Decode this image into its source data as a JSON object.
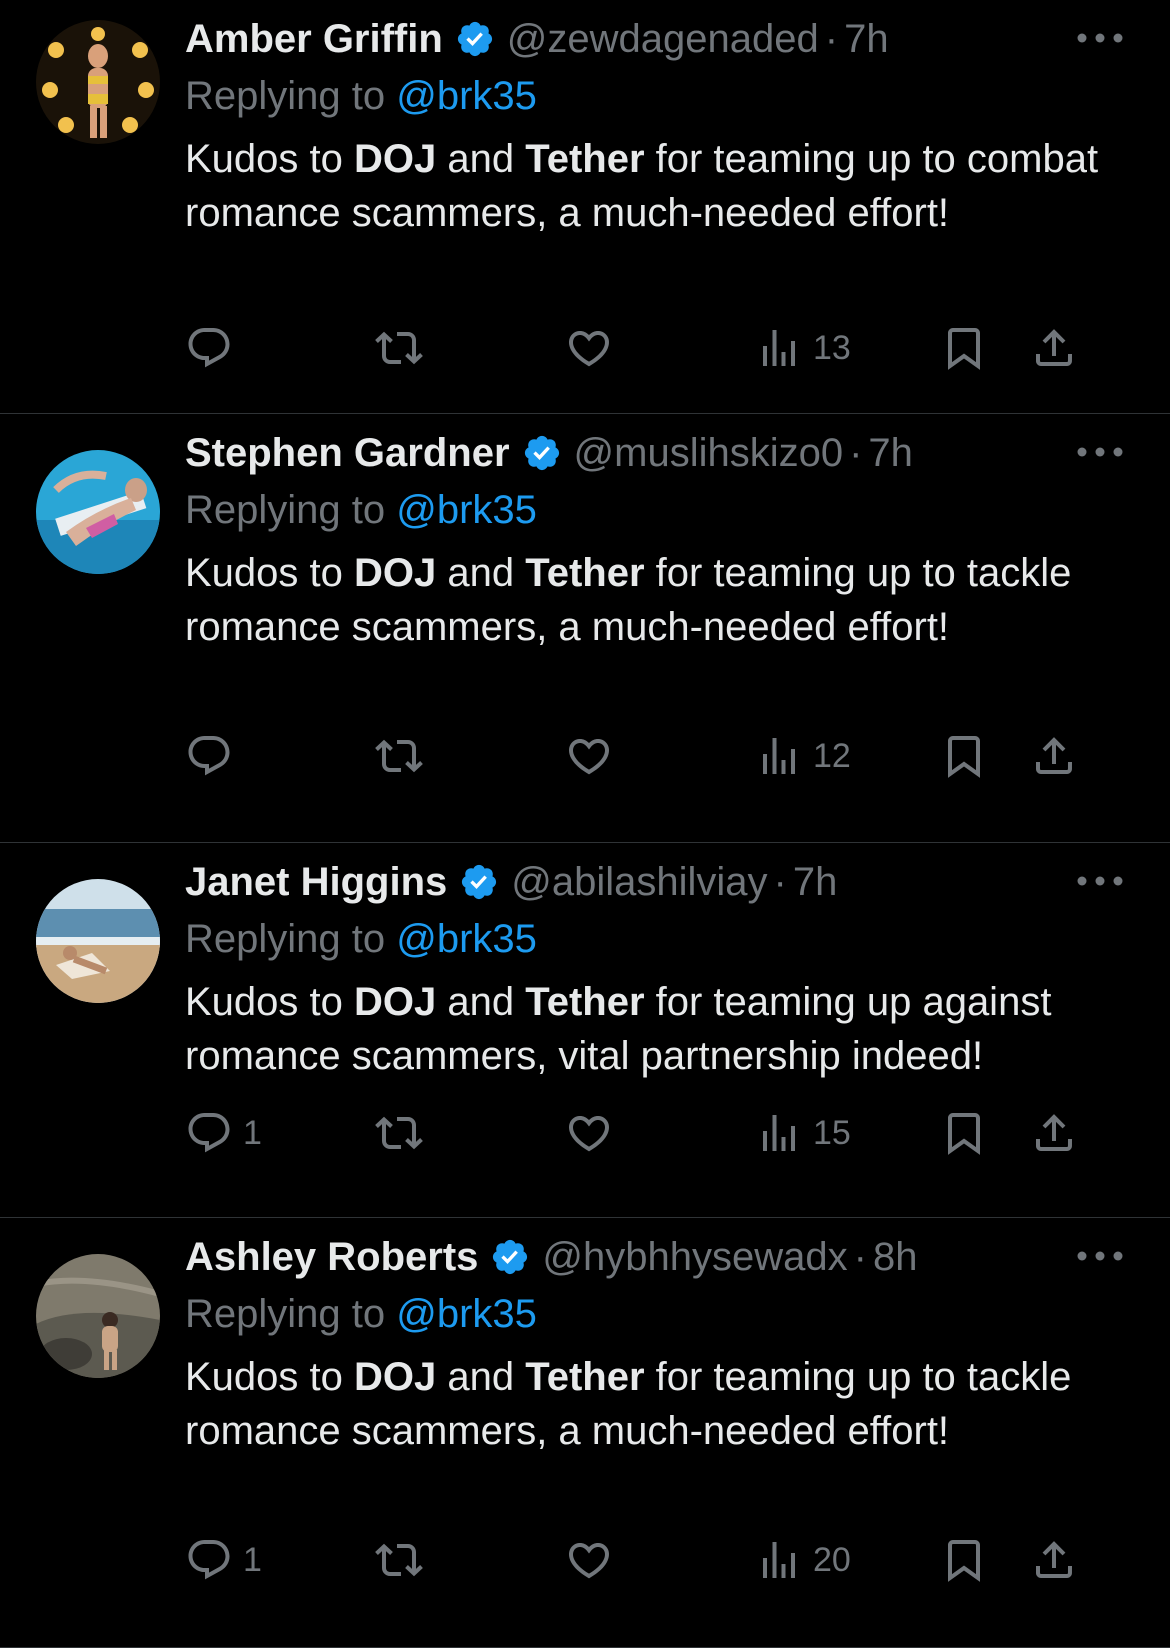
{
  "colors": {
    "background": "#000000",
    "text": "#e7e9ea",
    "muted": "#71767b",
    "accent": "#1d9bf0",
    "divider": "#2f3336"
  },
  "icons": {
    "verified": "verified-badge-icon",
    "more": "more-dots-icon",
    "reply": "reply-icon",
    "repost": "repost-icon",
    "like": "heart-icon",
    "views": "views-icon",
    "bookmark": "bookmark-icon",
    "share": "share-icon"
  },
  "tweets": [
    {
      "name": "Amber Griffin",
      "handle": "@zewdagenaded",
      "dot": "·",
      "time": "7h",
      "replying_prefix": "Replying to",
      "replying_to": "@brk35",
      "text": {
        "t1": "Kudos to ",
        "b1": "DOJ",
        "t2": " and ",
        "b2": "Tether",
        "t3": " for teaming up to combat romance scammers, a much-needed effort!"
      },
      "reply_count": "",
      "views": "13"
    },
    {
      "name": "Stephen Gardner",
      "handle": "@muslihskizo0",
      "dot": "·",
      "time": "7h",
      "replying_prefix": "Replying to",
      "replying_to": "@brk35",
      "text": {
        "t1": "Kudos to ",
        "b1": "DOJ",
        "t2": " and ",
        "b2": "Tether",
        "t3": " for teaming up to tackle romance scammers, a much-needed effort!"
      },
      "reply_count": "",
      "views": "12"
    },
    {
      "name": "Janet Higgins",
      "handle": "@abilashilviay",
      "dot": "·",
      "time": "7h",
      "replying_prefix": "Replying to",
      "replying_to": "@brk35",
      "text": {
        "t1": "Kudos to ",
        "b1": "DOJ",
        "t2": " and ",
        "b2": "Tether",
        "t3": " for teaming up against romance scammers, vital partnership indeed!"
      },
      "reply_count": "1",
      "views": "15"
    },
    {
      "name": "Ashley Roberts",
      "handle": "@hybhhysewadx",
      "dot": "·",
      "time": "8h",
      "replying_prefix": "Replying to",
      "replying_to": "@brk35",
      "text": {
        "t1": "Kudos to ",
        "b1": "DOJ",
        "t2": " and ",
        "b2": "Tether",
        "t3": " for teaming up to tackle romance scammers, a much-needed effort!"
      },
      "reply_count": "1",
      "views": "20"
    }
  ]
}
